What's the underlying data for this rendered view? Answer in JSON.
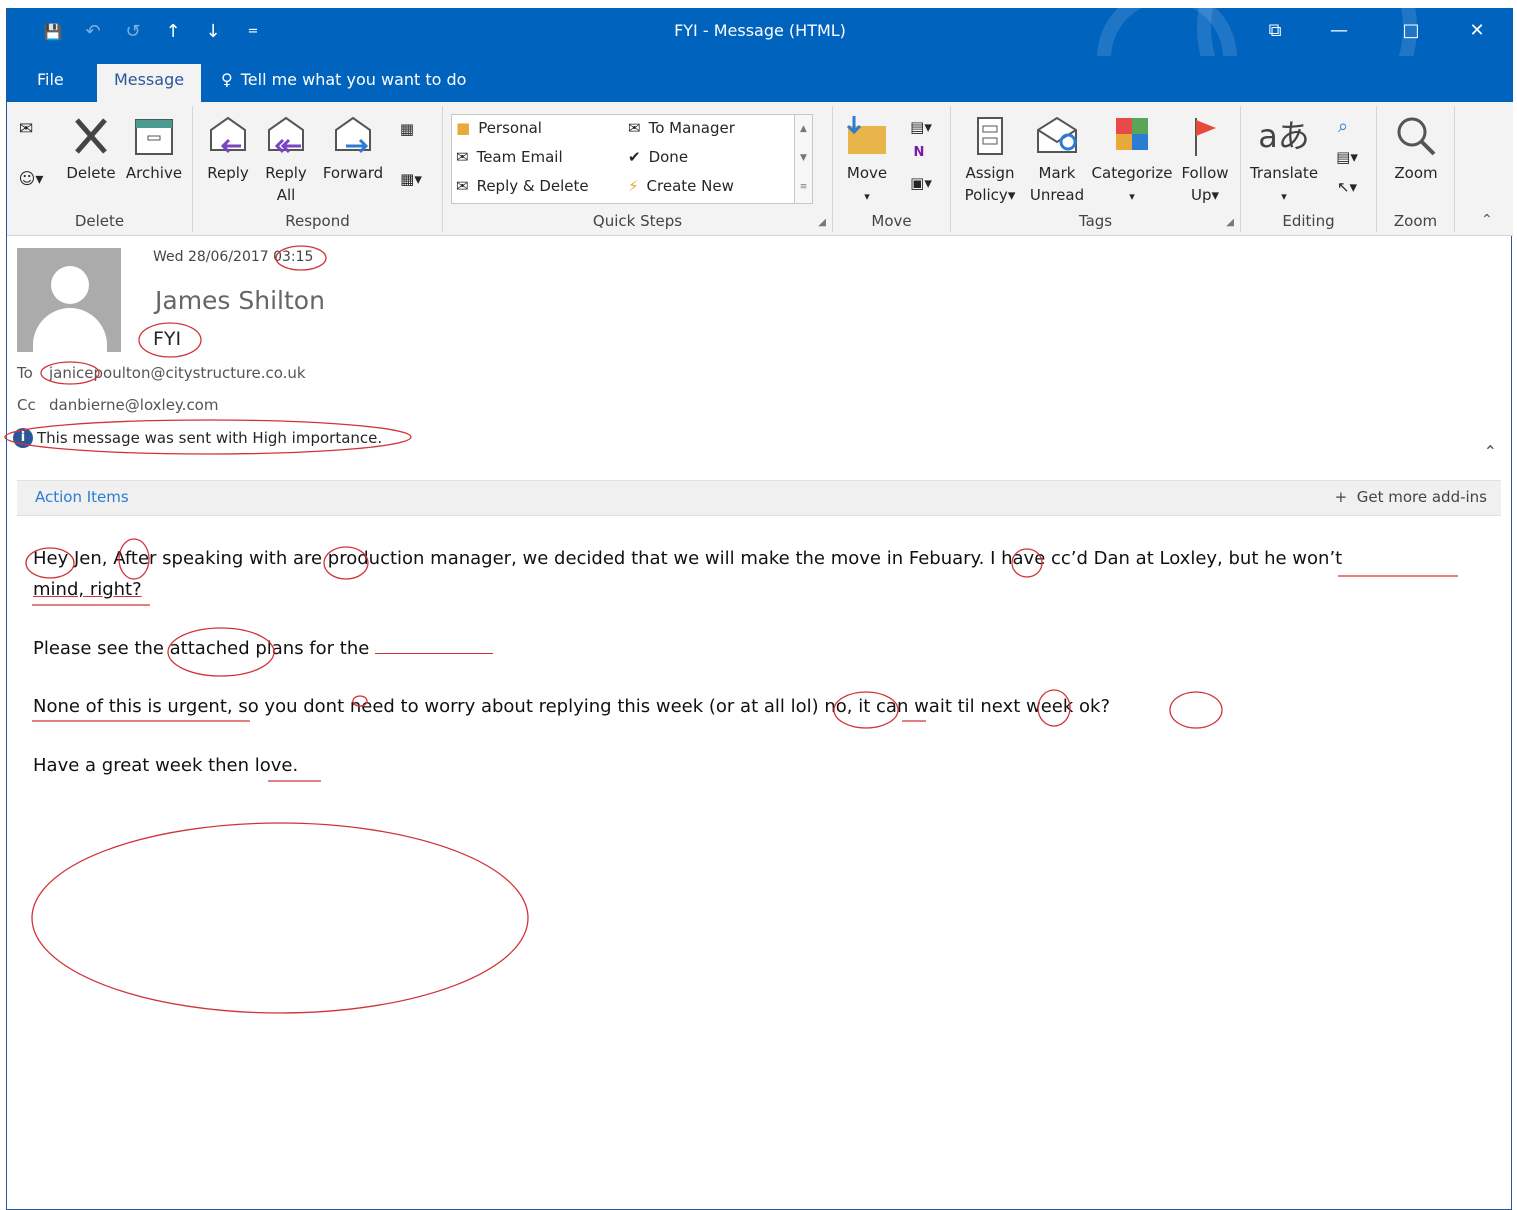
{
  "titlebar": {
    "title": "FYI  -  Message (HTML)",
    "qat": [
      {
        "icon": "save-icon",
        "glyph": "💾"
      },
      {
        "icon": "undo-icon",
        "glyph": "↶"
      },
      {
        "icon": "redo-icon",
        "glyph": "↺"
      },
      {
        "icon": "previous-item-icon",
        "glyph": "↑"
      },
      {
        "icon": "next-item-icon",
        "glyph": "↓"
      },
      {
        "icon": "customize-qat-icon",
        "glyph": "="
      }
    ],
    "controls": {
      "ribbon_display": "⧉",
      "minimize": "—",
      "maximize": "□",
      "close": "✕"
    }
  },
  "tabs": {
    "file": "File",
    "message": "Message",
    "tell_me": "Tell me what you want to do"
  },
  "ribbon": {
    "delete_group": {
      "label": "Delete",
      "delete": "Delete",
      "archive": "Archive"
    },
    "respond_group": {
      "label": "Respond",
      "reply": "Reply",
      "reply_all_1": "Reply",
      "reply_all_2": "All",
      "forward": "Forward"
    },
    "quick_steps": {
      "label": "Quick Steps",
      "items": [
        "Personal",
        "To Manager",
        "Team Email",
        "Done",
        "Reply & Delete",
        "Create New"
      ]
    },
    "move_group": {
      "label": "Move",
      "move": "Move"
    },
    "tags_group": {
      "label": "Tags",
      "assign_1": "Assign",
      "assign_2": "Policy",
      "mark_1": "Mark",
      "mark_2": "Unread",
      "categorize": "Categorize",
      "follow_1": "Follow",
      "follow_2": "Up"
    },
    "editing_group": {
      "label": "Editing",
      "translate": "Translate"
    },
    "zoom_group": {
      "label": "Zoom",
      "zoom": "Zoom"
    }
  },
  "header": {
    "date": "Wed 28/06/2017 03:15",
    "from": "James Shilton",
    "subject": "FYI",
    "to_label": "To",
    "to": "janicepoulton@citystructure.co.uk",
    "cc_label": "Cc",
    "cc": "danbierne@loxley.com",
    "importance": "This message was sent with High importance."
  },
  "actionbar": {
    "action_items": "Action Items",
    "get_addins": "Get more add-ins"
  },
  "body": {
    "p1a": "Hey Jen, After speaking with are production manager, we decided that we will make the move in Febuary. I have cc’d Dan at Loxley, but he won’t",
    "p1b": "mind, right?",
    "p2": "Please see the attached plans for the ",
    "p3": "None of this is urgent, so you dont need to worry about replying this week (or at all lol) no, it can wait til next week ok?",
    "p4": "Have a great week then love."
  },
  "colors": {
    "title_blue": "#0064bf",
    "annotation_red": "#d13438",
    "link_blue": "#2b7cd3"
  }
}
